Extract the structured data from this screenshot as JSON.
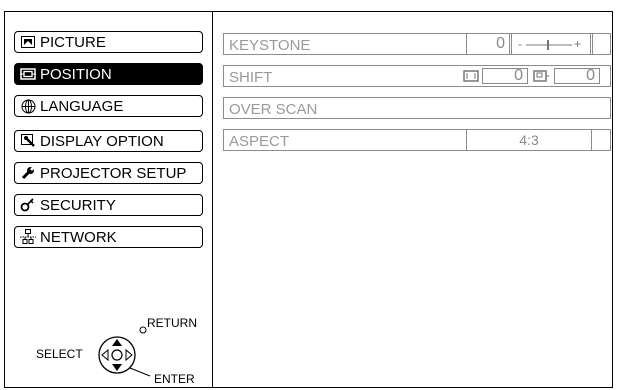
{
  "menu": {
    "items": [
      {
        "label": "PICTURE",
        "icon": "picture-icon"
      },
      {
        "label": "POSITION",
        "icon": "position-icon",
        "active": true
      },
      {
        "label": "LANGUAGE",
        "icon": "globe-icon"
      },
      {
        "label": "DISPLAY OPTION",
        "icon": "display-option-icon"
      },
      {
        "label": "PROJECTOR SETUP",
        "icon": "wrench-icon"
      },
      {
        "label": "SECURITY",
        "icon": "key-icon"
      },
      {
        "label": "NETWORK",
        "icon": "network-icon"
      }
    ]
  },
  "panel": {
    "keystone": {
      "label": "KEYSTONE",
      "value": "0",
      "slider_minus": "-",
      "slider_plus": "+"
    },
    "shift": {
      "label": "SHIFT",
      "horizontal_value": "0",
      "vertical_value": "0"
    },
    "overscan": {
      "label": "OVER SCAN"
    },
    "aspect": {
      "label": "ASPECT",
      "value": "4:3"
    }
  },
  "controls": {
    "select": "SELECT",
    "return": "RETURN",
    "enter": "ENTER"
  },
  "colors": {
    "active_bg": "#000000",
    "disabled_text": "#9a9a9a",
    "border": "#000000"
  }
}
